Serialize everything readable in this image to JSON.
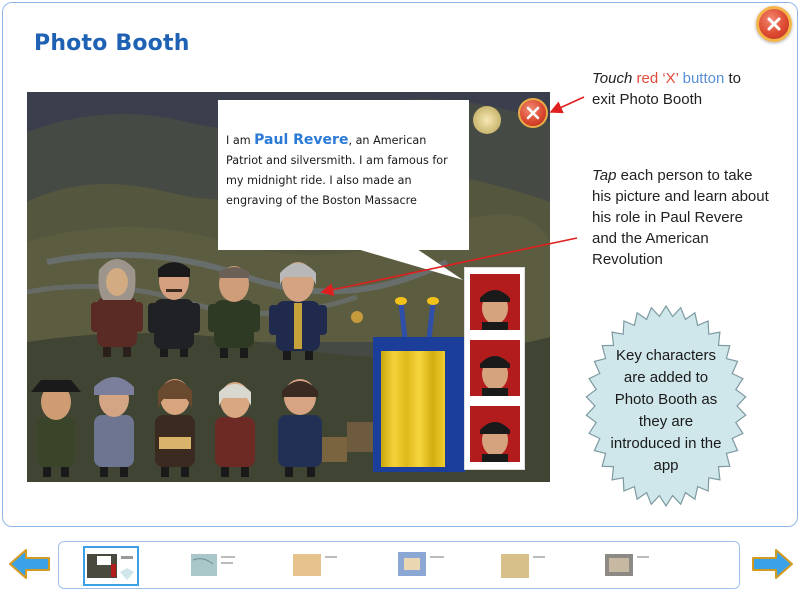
{
  "page": {
    "title": "Photo Booth"
  },
  "close_icon": "close-x-icon",
  "scene": {
    "bubble": {
      "prefix": "I am ",
      "name": "Paul Revere",
      "suffix": ", an American Patriot and silversmith.  I am famous for my midnight ride.  I also made an engraving of the Boston Massacre"
    },
    "close_icon": "close-x-icon"
  },
  "annotations": {
    "note1": {
      "touch": "Touch",
      "red": "red ‘X’",
      "button": "button",
      "rest": "to exit Photo Booth"
    },
    "note2": {
      "tap": "Tap",
      "rest": "each person to take his picture and learn about his role in Paul Revere and the American Revolution"
    },
    "callout": "Key characters are added to Photo Booth as they are introduced in the app"
  },
  "navigation": {
    "prev_icon": "arrow-left-icon",
    "next_icon": "arrow-right-icon",
    "selected_index": 0
  },
  "colors": {
    "title_blue": "#1f62b3",
    "accent_red": "#e24a3a",
    "accent_blue": "#5a8fd6",
    "callout_fill": "#cfe6ea"
  }
}
